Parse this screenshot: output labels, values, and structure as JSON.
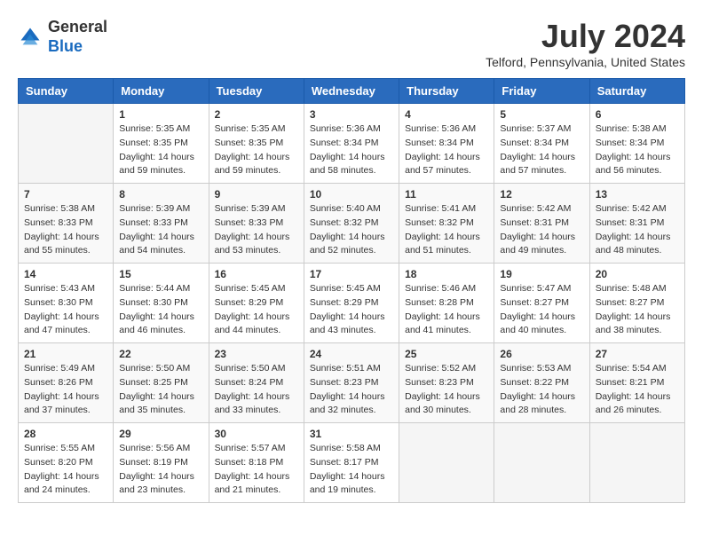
{
  "header": {
    "logo_general": "General",
    "logo_blue": "Blue",
    "month_year": "July 2024",
    "location": "Telford, Pennsylvania, United States"
  },
  "days_of_week": [
    "Sunday",
    "Monday",
    "Tuesday",
    "Wednesday",
    "Thursday",
    "Friday",
    "Saturday"
  ],
  "weeks": [
    [
      {
        "day": "",
        "info": ""
      },
      {
        "day": "1",
        "sunrise": "5:35 AM",
        "sunset": "8:35 PM",
        "daylight": "14 hours and 59 minutes."
      },
      {
        "day": "2",
        "sunrise": "5:35 AM",
        "sunset": "8:35 PM",
        "daylight": "14 hours and 59 minutes."
      },
      {
        "day": "3",
        "sunrise": "5:36 AM",
        "sunset": "8:34 PM",
        "daylight": "14 hours and 58 minutes."
      },
      {
        "day": "4",
        "sunrise": "5:36 AM",
        "sunset": "8:34 PM",
        "daylight": "14 hours and 57 minutes."
      },
      {
        "day": "5",
        "sunrise": "5:37 AM",
        "sunset": "8:34 PM",
        "daylight": "14 hours and 57 minutes."
      },
      {
        "day": "6",
        "sunrise": "5:38 AM",
        "sunset": "8:34 PM",
        "daylight": "14 hours and 56 minutes."
      }
    ],
    [
      {
        "day": "7",
        "sunrise": "5:38 AM",
        "sunset": "8:33 PM",
        "daylight": "14 hours and 55 minutes."
      },
      {
        "day": "8",
        "sunrise": "5:39 AM",
        "sunset": "8:33 PM",
        "daylight": "14 hours and 54 minutes."
      },
      {
        "day": "9",
        "sunrise": "5:39 AM",
        "sunset": "8:33 PM",
        "daylight": "14 hours and 53 minutes."
      },
      {
        "day": "10",
        "sunrise": "5:40 AM",
        "sunset": "8:32 PM",
        "daylight": "14 hours and 52 minutes."
      },
      {
        "day": "11",
        "sunrise": "5:41 AM",
        "sunset": "8:32 PM",
        "daylight": "14 hours and 51 minutes."
      },
      {
        "day": "12",
        "sunrise": "5:42 AM",
        "sunset": "8:31 PM",
        "daylight": "14 hours and 49 minutes."
      },
      {
        "day": "13",
        "sunrise": "5:42 AM",
        "sunset": "8:31 PM",
        "daylight": "14 hours and 48 minutes."
      }
    ],
    [
      {
        "day": "14",
        "sunrise": "5:43 AM",
        "sunset": "8:30 PM",
        "daylight": "14 hours and 47 minutes."
      },
      {
        "day": "15",
        "sunrise": "5:44 AM",
        "sunset": "8:30 PM",
        "daylight": "14 hours and 46 minutes."
      },
      {
        "day": "16",
        "sunrise": "5:45 AM",
        "sunset": "8:29 PM",
        "daylight": "14 hours and 44 minutes."
      },
      {
        "day": "17",
        "sunrise": "5:45 AM",
        "sunset": "8:29 PM",
        "daylight": "14 hours and 43 minutes."
      },
      {
        "day": "18",
        "sunrise": "5:46 AM",
        "sunset": "8:28 PM",
        "daylight": "14 hours and 41 minutes."
      },
      {
        "day": "19",
        "sunrise": "5:47 AM",
        "sunset": "8:27 PM",
        "daylight": "14 hours and 40 minutes."
      },
      {
        "day": "20",
        "sunrise": "5:48 AM",
        "sunset": "8:27 PM",
        "daylight": "14 hours and 38 minutes."
      }
    ],
    [
      {
        "day": "21",
        "sunrise": "5:49 AM",
        "sunset": "8:26 PM",
        "daylight": "14 hours and 37 minutes."
      },
      {
        "day": "22",
        "sunrise": "5:50 AM",
        "sunset": "8:25 PM",
        "daylight": "14 hours and 35 minutes."
      },
      {
        "day": "23",
        "sunrise": "5:50 AM",
        "sunset": "8:24 PM",
        "daylight": "14 hours and 33 minutes."
      },
      {
        "day": "24",
        "sunrise": "5:51 AM",
        "sunset": "8:23 PM",
        "daylight": "14 hours and 32 minutes."
      },
      {
        "day": "25",
        "sunrise": "5:52 AM",
        "sunset": "8:23 PM",
        "daylight": "14 hours and 30 minutes."
      },
      {
        "day": "26",
        "sunrise": "5:53 AM",
        "sunset": "8:22 PM",
        "daylight": "14 hours and 28 minutes."
      },
      {
        "day": "27",
        "sunrise": "5:54 AM",
        "sunset": "8:21 PM",
        "daylight": "14 hours and 26 minutes."
      }
    ],
    [
      {
        "day": "28",
        "sunrise": "5:55 AM",
        "sunset": "8:20 PM",
        "daylight": "14 hours and 24 minutes."
      },
      {
        "day": "29",
        "sunrise": "5:56 AM",
        "sunset": "8:19 PM",
        "daylight": "14 hours and 23 minutes."
      },
      {
        "day": "30",
        "sunrise": "5:57 AM",
        "sunset": "8:18 PM",
        "daylight": "14 hours and 21 minutes."
      },
      {
        "day": "31",
        "sunrise": "5:58 AM",
        "sunset": "8:17 PM",
        "daylight": "14 hours and 19 minutes."
      },
      {
        "day": "",
        "info": ""
      },
      {
        "day": "",
        "info": ""
      },
      {
        "day": "",
        "info": ""
      }
    ]
  ],
  "labels": {
    "sunrise": "Sunrise:",
    "sunset": "Sunset:",
    "daylight": "Daylight:"
  }
}
